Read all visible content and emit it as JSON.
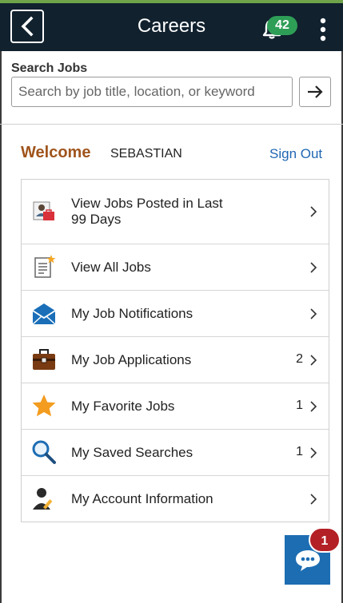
{
  "header": {
    "title": "Careers",
    "notification_count": "42",
    "back_icon": "chevron-left-icon",
    "notifications_icon": "bell-icon",
    "more_icon": "kebab-menu-icon",
    "background_color": "#11212e"
  },
  "search": {
    "label": "Search Jobs",
    "placeholder": "Search by job title, location, or keyword",
    "value": "",
    "go_icon": "arrow-right-icon"
  },
  "welcome": {
    "greeting": "Welcome",
    "user_name": "SEBASTIAN",
    "sign_out": "Sign Out"
  },
  "menu": {
    "items": [
      {
        "label_line1": "View Jobs Posted in Last",
        "label_line2": "99 Days",
        "count": "",
        "icon": "recent-jobs-icon"
      },
      {
        "label": "View All Jobs",
        "count": "",
        "icon": "document-list-icon"
      },
      {
        "label": "My Job Notifications",
        "count": "",
        "icon": "envelope-icon"
      },
      {
        "label": "My Job Applications",
        "count": "2",
        "icon": "briefcase-icon"
      },
      {
        "label": "My Favorite Jobs",
        "count": "1",
        "icon": "star-icon"
      },
      {
        "label": "My Saved Searches",
        "count": "1",
        "icon": "magnifier-icon"
      },
      {
        "label": "My Account Information",
        "count": "",
        "icon": "user-edit-icon"
      }
    ]
  },
  "chat": {
    "badge_count": "1",
    "icon": "chat-bubble-icon",
    "color": "#1d6db3"
  }
}
